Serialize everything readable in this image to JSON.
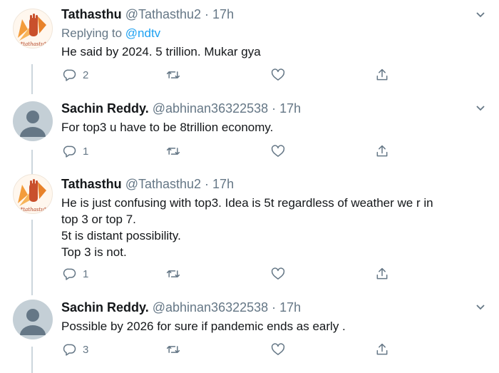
{
  "tweets": [
    {
      "name": "Tathasthu",
      "handle": "@Tathasthu2",
      "time": "· 17h",
      "avatar": "tathasthu-hand-logo",
      "avatar_caption": "*tathastu*",
      "replying_prefix": "Replying to",
      "replying_to": "@ndtv",
      "lines": [
        "He said by 2024. 5 trillion. Mukar gya"
      ],
      "reply_count": "2",
      "retweet_count": "",
      "like_count": ""
    },
    {
      "name": "Sachin Reddy.",
      "handle": "@abhinan36322538",
      "time": "· 17h",
      "avatar": "default-profile",
      "lines": [
        "For top3 u have to be 8trillion economy."
      ],
      "reply_count": "1",
      "retweet_count": "",
      "like_count": ""
    },
    {
      "name": "Tathasthu",
      "handle": "@Tathasthu2",
      "time": "· 17h",
      "avatar": "tathasthu-hand-logo",
      "avatar_caption": "*tathastu*",
      "lines": [
        "He is just confusing with top3. Idea is 5t regardless of weather we r in",
        "top 3 or top 7.",
        "5t is distant possibility.",
        "Top 3 is not."
      ],
      "reply_count": "1",
      "retweet_count": "",
      "like_count": ""
    },
    {
      "name": "Sachin Reddy.",
      "handle": "@abhinan36322538",
      "time": "· 17h",
      "avatar": "default-profile",
      "lines": [
        "Possible by 2026 for sure if pandemic ends as early ."
      ],
      "reply_count": "3",
      "retweet_count": "",
      "like_count": ""
    }
  ],
  "icons": {
    "reply": "reply-icon",
    "retweet": "retweet-icon",
    "like": "heart-icon",
    "share": "share-icon",
    "more": "chevron-down-icon"
  },
  "colors": {
    "link": "#1da1f2",
    "secondary_text": "#657786",
    "thread_line": "#ccd6dd"
  }
}
